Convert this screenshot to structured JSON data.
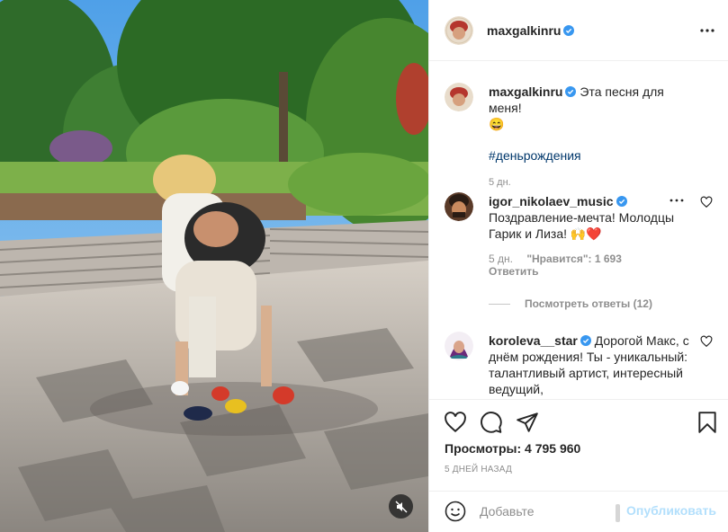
{
  "post": {
    "author": "maxgalkinru",
    "media": {
      "type": "video",
      "mute_icon": "speaker-muted-icon"
    }
  },
  "caption": {
    "username": "maxgalkinru",
    "text": "Эта песня для меня!",
    "emoji": "😄",
    "hashtag": "#деньрождения",
    "time": "5 дн."
  },
  "comments": [
    {
      "username": "igor_nikolaev_music",
      "text": "Поздравление-мечта! Молодцы Гарик и Лиза! 🙌❤️",
      "time": "5 дн.",
      "likes": "\"Нравится\": 1 693",
      "reply_label": "Ответить"
    },
    {
      "username": "koroleva__star",
      "text": "Дорогой Макс, с днём рождения! Ты - уникальный: талантливый артист, интересный ведущий,"
    }
  ],
  "replies_toggle": "Посмотреть ответы (12)",
  "actions": {
    "views": "Просмотры: 4 795 960",
    "date": "5 ДНЕЙ НАЗАД"
  },
  "add_comment": {
    "placeholder": "Добавьте",
    "post_label": "Опубликовать"
  },
  "colors": {
    "link": "#00376b",
    "verified": "#3897f0",
    "post_disabled": "#b2dffc",
    "muted": "#8e8e8e"
  }
}
